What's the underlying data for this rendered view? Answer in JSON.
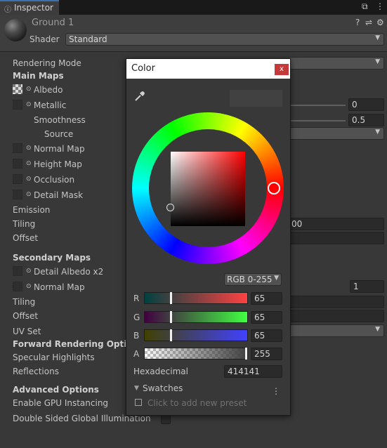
{
  "tab": {
    "icon": "info-icon",
    "title": "Inspector"
  },
  "window_buttons": {
    "lock": "⧉",
    "menu": "⋮"
  },
  "material": {
    "name": "Ground 1",
    "shader_label": "Shader",
    "shader_value": "Standard"
  },
  "header_icons": {
    "help": "?",
    "presets": "⇌",
    "settings": "⚙"
  },
  "props": {
    "rendering_mode": "Rendering Mode",
    "main_maps": "Main Maps",
    "albedo": "Albedo",
    "metallic": "Metallic",
    "smoothness": "Smoothness",
    "source": "Source",
    "normal_map": "Normal Map",
    "height_map": "Height Map",
    "occlusion": "Occlusion",
    "detail_mask": "Detail Mask",
    "emission": "Emission",
    "tiling": "Tiling",
    "offset": "Offset",
    "secondary_maps": "Secondary Maps",
    "detail_albedo": "Detail Albedo x2",
    "normal_map2": "Normal Map",
    "tiling2": "Tiling",
    "offset2": "Offset",
    "uv_set": "UV Set",
    "forward_rendering": "Forward Rendering Options",
    "specular_highlights": "Specular Highlights",
    "reflections": "Reflections",
    "advanced_options": "Advanced Options",
    "gpu_instancing": "Enable GPU Instancing",
    "double_sided_gi": "Double Sided Global Illumination"
  },
  "values": {
    "metallic": "0",
    "smoothness": "0.5",
    "tiling_partial": "00",
    "secondary_normal_scale": "1"
  },
  "color_picker": {
    "title": "Color",
    "close": "x",
    "mode": "RGB 0-255",
    "channels": [
      {
        "label": "R",
        "value": "65",
        "fraction": 0.255
      },
      {
        "label": "G",
        "value": "65",
        "fraction": 0.255
      },
      {
        "label": "B",
        "value": "65",
        "fraction": 0.255
      },
      {
        "label": "A",
        "value": "255",
        "fraction": 1.0
      }
    ],
    "hex_label": "Hexadecimal",
    "hex_value": "414141",
    "swatches_label": "Swatches",
    "swatches_menu": "⋮",
    "preset_hint": "Click to add new preset",
    "colors": {
      "current": "#414141",
      "hue": "#ff0000"
    }
  }
}
